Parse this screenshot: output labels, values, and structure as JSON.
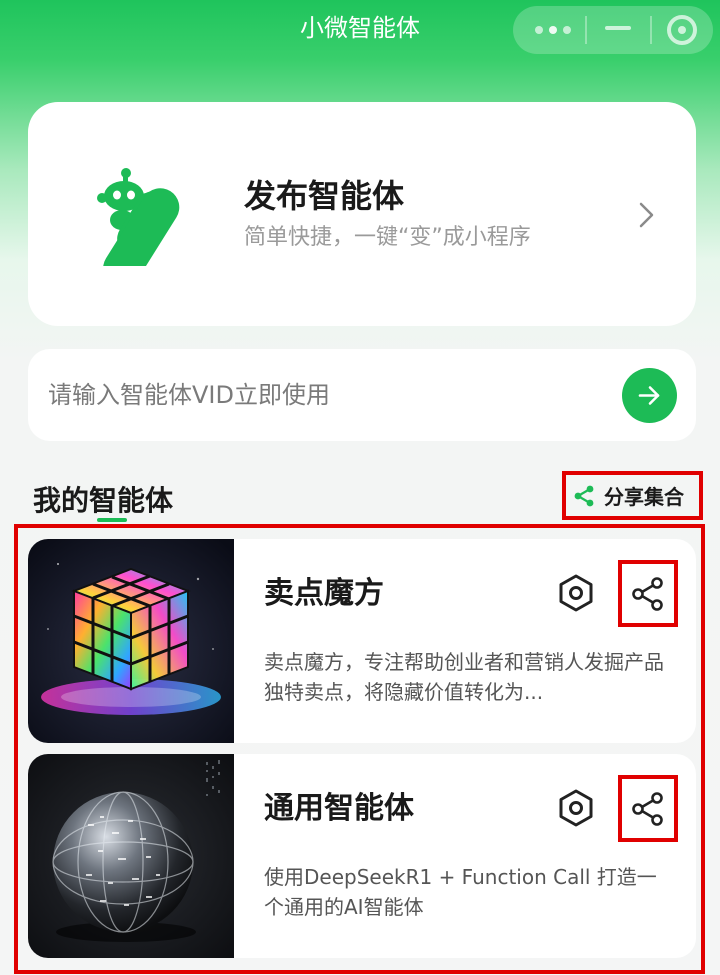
{
  "app": {
    "title": "小微智能体"
  },
  "publish_card": {
    "title": "发布智能体",
    "subtitle": "简单快捷，一键“变”成小程序",
    "logo_icon": "robot-slash-logo-icon",
    "chevron_icon": "chevron-right-icon"
  },
  "vid_search": {
    "placeholder": "请输入智能体VID立即使用",
    "value": "",
    "go_icon": "arrow-right-icon"
  },
  "my_agents": {
    "title": "我的智能体",
    "share_collection_label": "分享集合",
    "share_collection_icon": "share-icon",
    "items": [
      {
        "name": "卖点魔方",
        "description": "卖点魔方，专注帮助创业者和营销人发掘产品独特卖点，将隐藏价值转化为...",
        "thumbnail": "glowing-rubiks-cube-image",
        "settings_icon": "hexagon-settings-icon",
        "share_icon": "share-icon"
      },
      {
        "name": "通用智能体",
        "description": "使用DeepSeekR1 + Function Call 打造一个通用的AI智能体",
        "thumbnail": "digital-sphere-image",
        "settings_icon": "hexagon-settings-icon",
        "share_icon": "share-icon"
      }
    ]
  },
  "colors": {
    "brand_green": "#1dbb56",
    "header_green": "#1fc45c",
    "highlight_red": "#e00000",
    "background": "#f4f5f5"
  }
}
